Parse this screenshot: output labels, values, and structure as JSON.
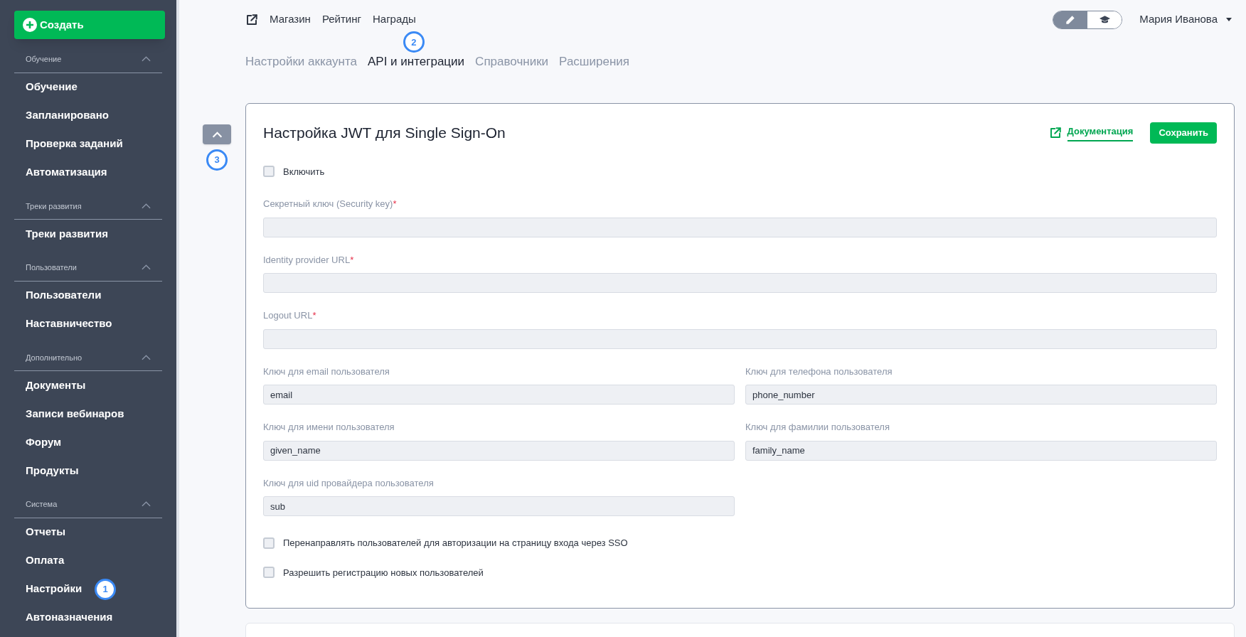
{
  "sidebar": {
    "create_button": "Создать",
    "sections": [
      {
        "title": "Обучение",
        "expanded": true,
        "items": [
          {
            "label": "Обучение"
          },
          {
            "label": "Запланировано"
          },
          {
            "label": "Проверка заданий"
          },
          {
            "label": "Автоматизация"
          }
        ]
      },
      {
        "title": "Треки развития",
        "expanded": true,
        "items": [
          {
            "label": "Треки развития"
          }
        ]
      },
      {
        "title": "Пользователи",
        "expanded": true,
        "items": [
          {
            "label": "Пользователи"
          },
          {
            "label": "Наставничество"
          }
        ]
      },
      {
        "title": "Дополнительно",
        "expanded": true,
        "items": [
          {
            "label": "Документы"
          },
          {
            "label": "Записи вебинаров"
          },
          {
            "label": "Форум"
          },
          {
            "label": "Продукты"
          }
        ]
      },
      {
        "title": "Система",
        "expanded": true,
        "items": [
          {
            "label": "Отчеты"
          },
          {
            "label": "Оплата"
          },
          {
            "label": "Настройки",
            "callout": "1"
          },
          {
            "label": "Автоназначения"
          }
        ]
      }
    ]
  },
  "top_links": [
    "Магазин",
    "Рейтинг",
    "Награды"
  ],
  "mode_switch": [
    {
      "kind": "edit",
      "selected": true
    },
    {
      "kind": "learning",
      "selected": false
    }
  ],
  "user_menu": "Мария Иванова",
  "tabs": [
    {
      "label": "Настройки аккаунта",
      "selected": false
    },
    {
      "label": "API и интеграции",
      "selected": true,
      "callout": "2"
    },
    {
      "label": "Справочники",
      "selected": false
    },
    {
      "label": "Расширения",
      "selected": false
    }
  ],
  "collapse_button": {
    "callout": "3"
  },
  "card": {
    "title": "Настройка JWT для Single Sign-On",
    "doc_link": "Документация",
    "save_button": "Сохранить",
    "required_mark": "*",
    "enable": {
      "label": "Включить",
      "checked": false
    },
    "rows": [
      [
        {
          "label": "Секретный ключ (Security key)",
          "required": true
        }
      ],
      [
        {
          "label": "Identity provider URL",
          "required": true
        }
      ],
      [
        {
          "label": "Logout URL",
          "required": true
        }
      ],
      [
        {
          "label": "Ключ для email пользователя",
          "required": false,
          "value": "email"
        },
        {
          "label": "Ключ для телефона пользователя",
          "required": false,
          "value": "phone_number"
        }
      ],
      [
        {
          "label": "Ключ для имени пользователя",
          "required": false,
          "value": "given_name"
        },
        {
          "label": "Ключ для фамилии пользователя",
          "required": false,
          "value": "family_name"
        }
      ],
      [
        {
          "label": "Ключ для uid провайдера пользователя",
          "required": false,
          "value": "sub"
        }
      ]
    ],
    "options": [
      {
        "label": "Перенаправлять пользователей для авторизации на страницу входа через SSO",
        "checked": false
      },
      {
        "label": "Разрешить регистрацию новых пользователей",
        "checked": false
      }
    ]
  }
}
